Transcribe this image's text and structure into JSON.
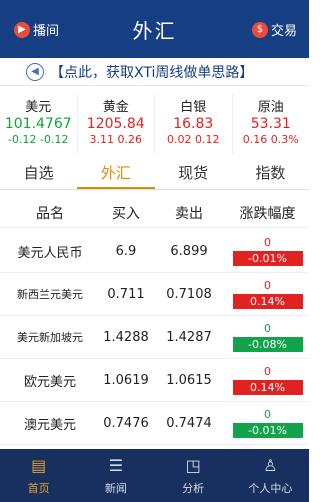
{
  "header": {
    "left_label": "播间",
    "title": "外汇",
    "right_label": "交易"
  },
  "notice": {
    "text": "【点此，获取XTi周线做单思路】"
  },
  "quotes": [
    {
      "name": "美元",
      "price": "101.4767",
      "change": "-0.12",
      "pct": "-0.12",
      "dir": "down"
    },
    {
      "name": "黄金",
      "price": "1205.84",
      "change": "3.11",
      "pct": "0.26",
      "dir": "up"
    },
    {
      "name": "白银",
      "price": "16.83",
      "change": "0.02",
      "pct": "0.12",
      "dir": "up"
    },
    {
      "name": "原油",
      "price": "53.31",
      "change": "0.16",
      "pct": "0.3%",
      "dir": "up"
    }
  ],
  "tabs": [
    "自选",
    "外汇",
    "现货",
    "指数"
  ],
  "active_tab": 1,
  "columns": [
    "品名",
    "买入",
    "卖出",
    "涨跌幅度"
  ],
  "rows": [
    {
      "name": "美元人民币",
      "buy": "6.9",
      "sell": "6.899",
      "top": "0",
      "pct": "-0.01%",
      "dir": "red"
    },
    {
      "name": "新西兰元美元",
      "buy": "0.711",
      "sell": "0.7108",
      "top": "0",
      "pct": "0.14%",
      "dir": "red"
    },
    {
      "name": "美元新加坡元",
      "buy": "1.4288",
      "sell": "1.4287",
      "top": "0",
      "pct": "-0.08%",
      "dir": "green"
    },
    {
      "name": "欧元美元",
      "buy": "1.0619",
      "sell": "1.0615",
      "top": "0",
      "pct": "0.14%",
      "dir": "red"
    },
    {
      "name": "澳元美元",
      "buy": "0.7476",
      "sell": "0.7474",
      "top": "0",
      "pct": "-0.01%",
      "dir": "green"
    }
  ],
  "footer": [
    {
      "label": "首页",
      "icon": "chart-icon"
    },
    {
      "label": "新闻",
      "icon": "news-icon"
    },
    {
      "label": "分析",
      "icon": "analysis-icon"
    },
    {
      "label": "个人中心",
      "icon": "person-icon"
    }
  ],
  "colors": {
    "header": "#163e82",
    "up": "#e02222",
    "down": "#10a535",
    "accent": "#e08a0a"
  }
}
